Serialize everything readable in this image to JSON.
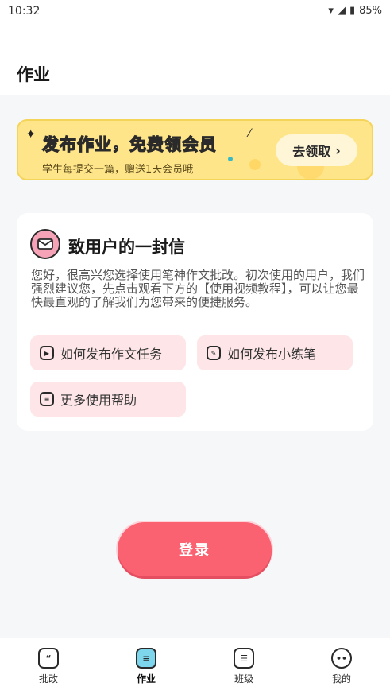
{
  "status_bar": {
    "time": "10:32",
    "battery": "85%"
  },
  "header": {
    "title": "作业"
  },
  "banner": {
    "headline": "发布作业，免费领会员",
    "subtitle": "学生每提交一篇，赠送1天会员哦",
    "cta": "去领取",
    "cta_icon": "chevron-right"
  },
  "letter": {
    "title": "致用户的一封信",
    "body": "您好，很高兴您选择使用笔神作文批改。初次使用的用户，我们强烈建议您，先点击观看下方的【使用视频教程】，可以让您最快最直观的了解我们为您带来的便捷服务。",
    "links": [
      {
        "label": "如何发布作文任务",
        "icon": "video-icon"
      },
      {
        "label": "如何发布小练笔",
        "icon": "edit-icon"
      },
      {
        "label": "更多使用帮助",
        "icon": "help-icon"
      }
    ]
  },
  "login_button": "登录",
  "tabs": [
    {
      "label": "批改",
      "icon": "quote-icon",
      "active": false
    },
    {
      "label": "作业",
      "icon": "clipboard-icon",
      "active": true
    },
    {
      "label": "班级",
      "icon": "class-icon",
      "active": false
    },
    {
      "label": "我的",
      "icon": "face-icon",
      "active": false
    }
  ]
}
